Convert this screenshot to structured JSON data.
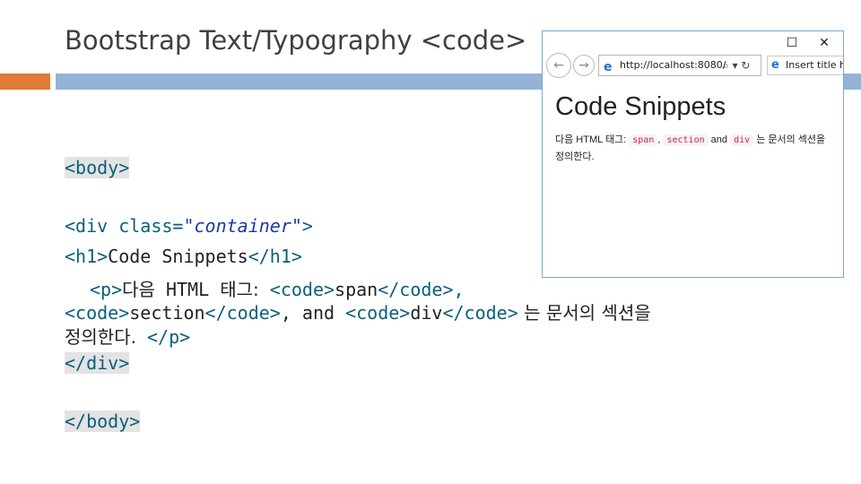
{
  "slide": {
    "title": "Bootstrap Text/Typography <code>"
  },
  "code_lines": {
    "l1": "<body>",
    "l2a": "<div class=",
    "l2b": "\"container\"",
    "l2c": ">",
    "l3a": "<h1>",
    "l3b": "Code Snippets",
    "l3c": "</h1>",
    "l4a": "<p>",
    "l4b": "다음",
    "l4c": " HTML ",
    "l4d": "태그:",
    "l4e": " <code>",
    "l4f": "span",
    "l4g": "</code>,",
    "l5a": "<code>",
    "l5b": "section",
    "l5c": "</code>",
    "l5d": ", and ",
    "l5e": "<code>",
    "l5f": "div",
    "l5g": "</code>",
    "l5h": " 는 문서의 섹션을",
    "l6a": "정의한다.",
    "l6b": " </p>",
    "l7": "</div>",
    "l8": "</body>"
  },
  "browser": {
    "win_min": "☐",
    "win_close": "✕",
    "back": "←",
    "forward": "→",
    "address": "http://localhost:8080/",
    "search_ctrl": "⌕ ▾ ↻",
    "tab_title": "Insert title here",
    "heading": "Code Snippets",
    "para_a": "다음 HTML 태그: ",
    "chip1": "span",
    "para_b": ", ",
    "chip2": "section",
    "para_c": " and ",
    "chip3": "div",
    "para_d": " 는 문서의 섹션을 정의한다."
  }
}
